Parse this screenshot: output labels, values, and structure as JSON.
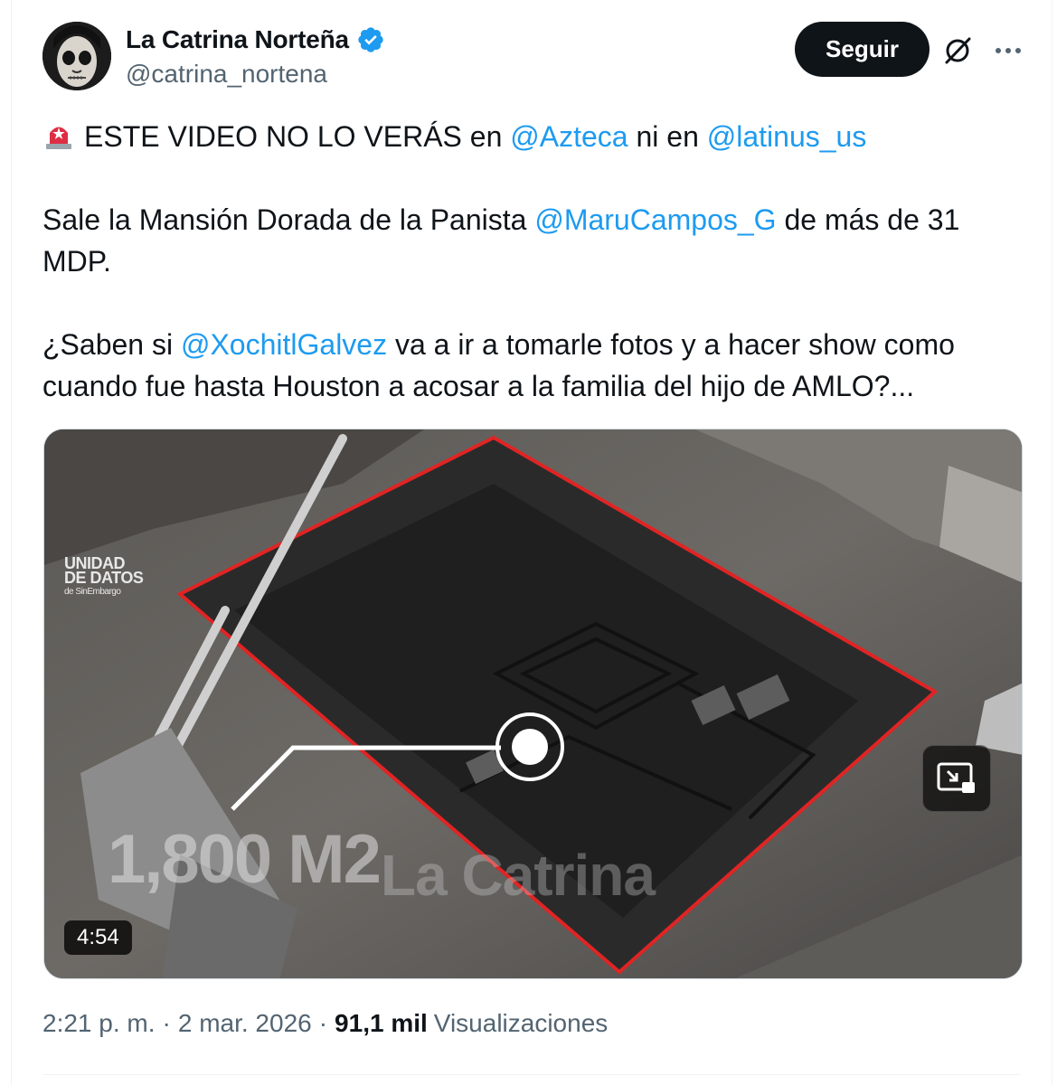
{
  "author": {
    "display_name": "La Catrina Norteña",
    "handle": "@catrina_nortena",
    "verified": true,
    "avatar_icon": "catrina-face-avatar"
  },
  "actions": {
    "follow_label": "Seguir",
    "grok_icon": "slashed-circle-icon",
    "more_icon": "more-dots-icon"
  },
  "tweet": {
    "line1": {
      "emoji": "rotating-light-icon",
      "text_a": "ESTE VIDEO NO LO VERÁS en ",
      "mention_a": "@Azteca",
      "text_b": " ni en ",
      "mention_b": "@latinus_us"
    },
    "line2": {
      "text_a": "Sale la Mansión Dorada de la Panista ",
      "mention_a": "@MaruCampos_G",
      "text_b": " de más de 31 MDP."
    },
    "line3": {
      "text_a": "¿Saben si ",
      "mention_a": "@XochitlGalvez",
      "text_b": " va a ir a tomarle fotos y a hacer show como cuando fue hasta Houston a acosar a la familia del hijo de AMLO?..."
    }
  },
  "media": {
    "type": "video",
    "duration": "4:54",
    "overlay_small": "UNIDAD DE DATOS",
    "overlay_small_sub": "de SinEmbargo",
    "overlay_area": "1,800 M2",
    "overlay_brand": "La Catrina",
    "pip_icon": "picture-in-picture-icon"
  },
  "meta": {
    "time": "2:21 p. m.",
    "separator": "·",
    "date": "2 mar. 2026",
    "separator2": "·",
    "views_count": "91,1 mil",
    "views_label": "Visualizaciones"
  },
  "colors": {
    "link": "#1d9bf0",
    "secondary_text": "#536471",
    "primary_text": "#0f1419",
    "verified": "#1d9bf0",
    "outline": "#e02424"
  }
}
